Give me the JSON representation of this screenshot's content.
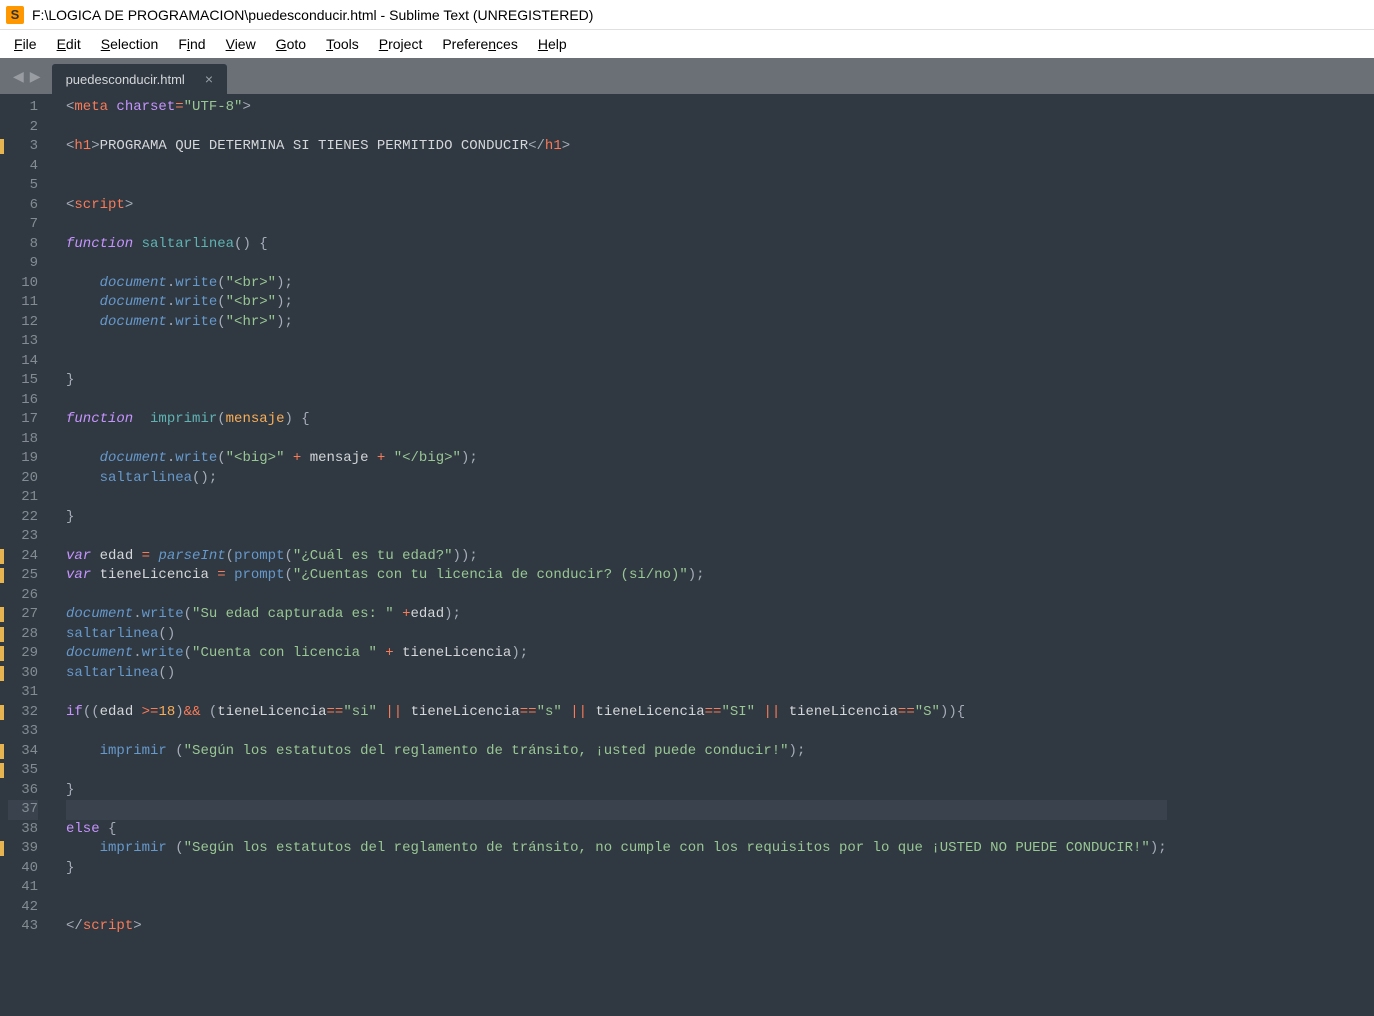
{
  "window": {
    "app_icon_letter": "S",
    "title": "F:\\LOGICA DE PROGRAMACION\\puedesconducir.html - Sublime Text (UNREGISTERED)"
  },
  "menu": {
    "file": "File",
    "edit": "Edit",
    "selection": "Selection",
    "find": "Find",
    "view": "View",
    "goto": "Goto",
    "tools": "Tools",
    "project": "Project",
    "preferences": "Preferences",
    "help": "Help"
  },
  "tabs": {
    "nav_prev": "◀",
    "nav_next": "▶",
    "active_name": "puedesconducir.html",
    "close": "×"
  },
  "gutter": {
    "total_lines": 43,
    "marked_lines": [
      3,
      24,
      25,
      27,
      28,
      29,
      30,
      32,
      34,
      35,
      39
    ],
    "cursor_line": 37
  },
  "code": {
    "tag_meta": "meta",
    "attr_charset": "charset",
    "str_utf8": "\"UTF-8\"",
    "tag_h1": "h1",
    "txt_h1": "PROGRAMA QUE DETERMINA SI TIENES PERMITIDO CONDUCIR",
    "tag_script": "script",
    "kw_function": "function",
    "fn_saltarlinea": "saltarlinea",
    "obj_document": "document",
    "m_write": "write",
    "str_br": "\"<br>\"",
    "str_hr": "\"<hr>\"",
    "fn_imprimir": "imprimir",
    "param_mensaje": "mensaje",
    "str_big_open": "\"<big>\"",
    "str_big_close": "\"</big>\"",
    "kw_var": "var",
    "id_edad": "edad",
    "fn_parseInt": "parseInt",
    "fn_prompt": "prompt",
    "str_prompt_edad": "\"¿Cuál es tu edad?\"",
    "id_tieneLicencia": "tieneLicencia",
    "str_prompt_lic": "\"¿Cuentas con tu licencia de conducir? (si/no)\"",
    "str_edad_cap": "\"Su edad capturada es: \"",
    "str_cuenta_lic": "\"Cuenta con licencia \"",
    "kw_if": "if",
    "num_18": "18",
    "str_si": "\"si\"",
    "str_s": "\"s\"",
    "str_SI": "\"SI\"",
    "str_S": "\"S\"",
    "str_puede": "\"Según los estatutos del reglamento de tránsito, ¡usted puede conducir!\"",
    "kw_else": "else",
    "str_nopuede": "\"Según los estatutos del reglamento de tránsito, no cumple con los requisitos por lo que ¡USTED NO PUEDE CONDUCIR!\""
  }
}
